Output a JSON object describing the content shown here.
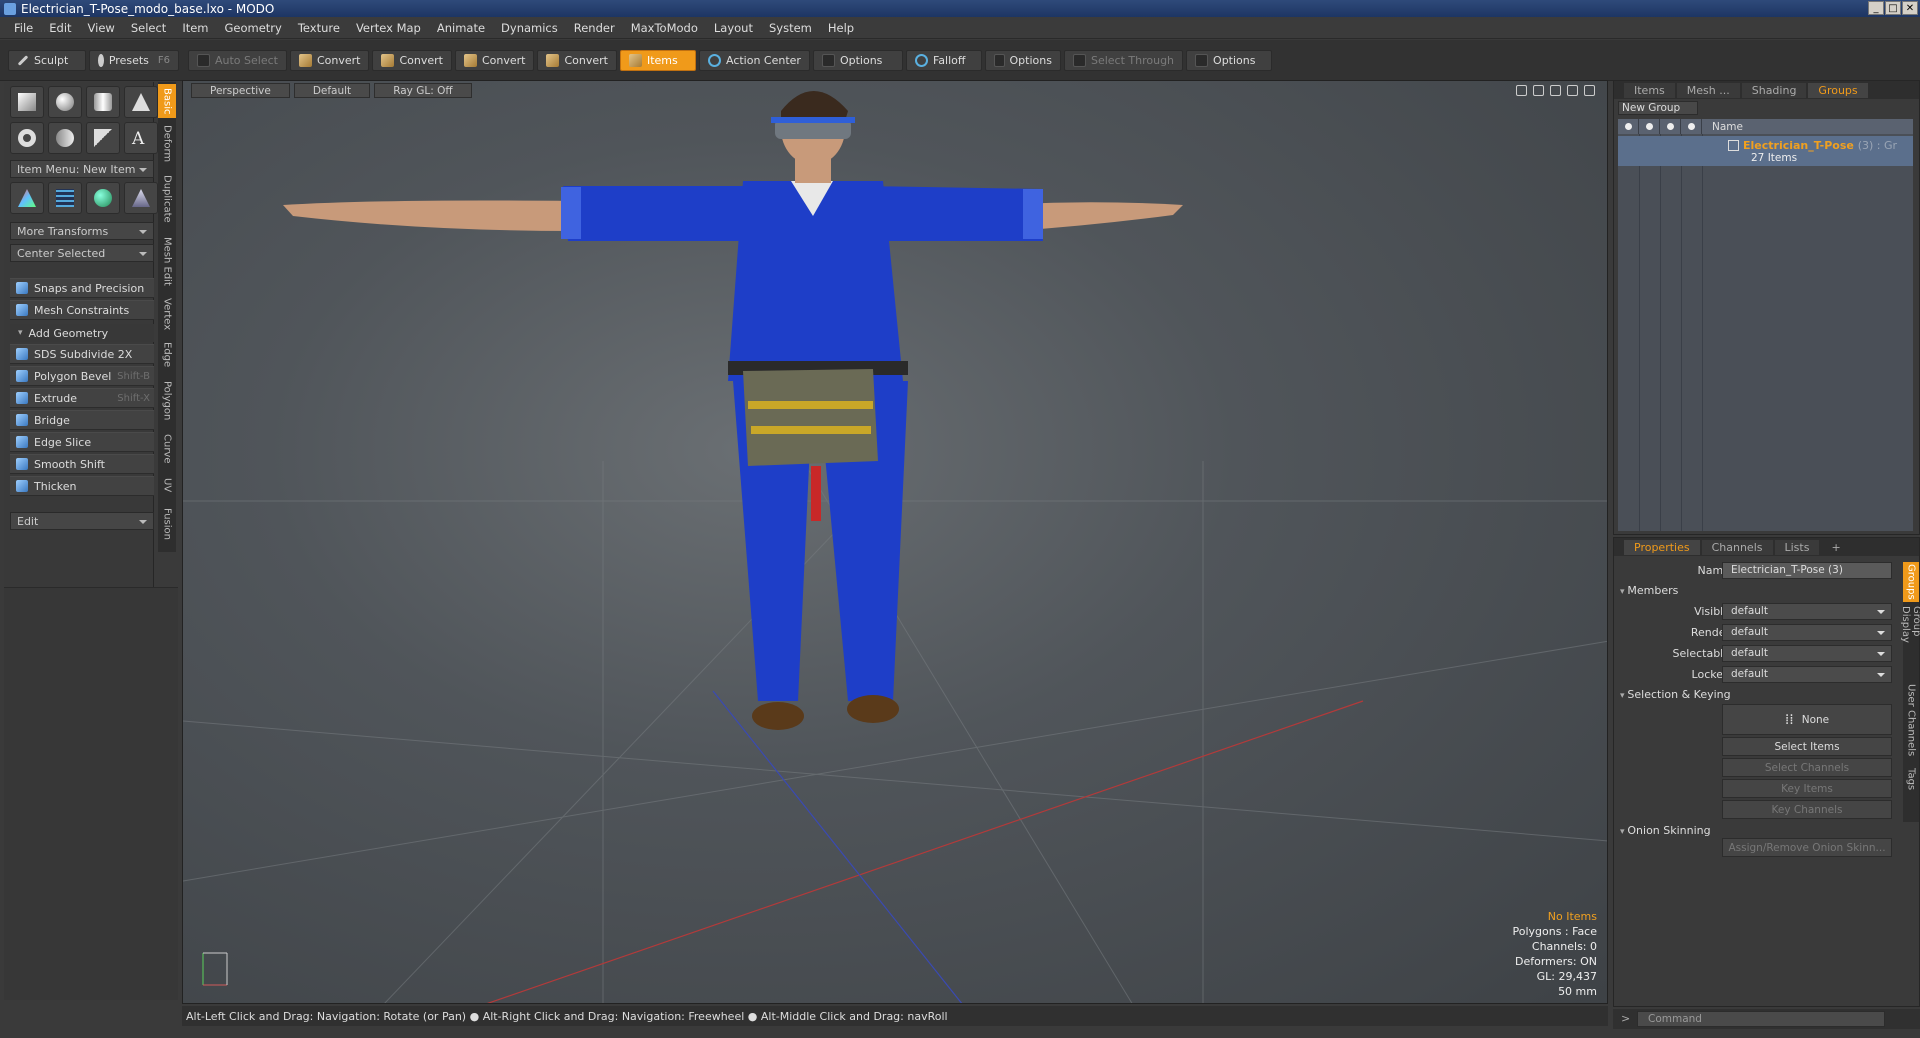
{
  "window": {
    "title": "Electrician_T-Pose_modo_base.lxo - MODO"
  },
  "menu": [
    "File",
    "Edit",
    "View",
    "Select",
    "Item",
    "Geometry",
    "Texture",
    "Vertex Map",
    "Animate",
    "Dynamics",
    "Render",
    "MaxToModo",
    "Layout",
    "System",
    "Help"
  ],
  "toolbar": {
    "sculpt": "Sculpt",
    "presets": "Presets",
    "presets_key": "F6",
    "auto_select": "Auto Select",
    "convert": "Convert",
    "items": "Items",
    "action_center": "Action Center",
    "options": "Options",
    "falloff": "Falloff",
    "select_through": "Select Through"
  },
  "left": {
    "item_menu": "Item Menu: New Item",
    "more_transforms": "More Transforms",
    "center_selected": "Center Selected",
    "snaps": "Snaps and Precision",
    "mesh_constraints": "Mesh Constraints",
    "add_geometry": "Add Geometry",
    "tools": [
      {
        "label": "SDS Subdivide 2X",
        "key": ""
      },
      {
        "label": "Polygon Bevel",
        "key": "Shift-B"
      },
      {
        "label": "Extrude",
        "key": "Shift-X"
      },
      {
        "label": "Bridge",
        "key": ""
      },
      {
        "label": "Edge Slice",
        "key": ""
      },
      {
        "label": "Smooth Shift",
        "key": ""
      },
      {
        "label": "Thicken",
        "key": ""
      }
    ],
    "edit": "Edit",
    "vtabs": [
      "Basic",
      "Deform",
      "Duplicate",
      "Mesh Edit",
      "Vertex",
      "Edge",
      "Polygon",
      "Curve",
      "UV",
      "Fusion"
    ]
  },
  "viewport": {
    "perspective": "Perspective",
    "default": "Default",
    "raygl": "Ray GL: Off",
    "info": {
      "items": "No Items",
      "polygons": "Polygons : Face",
      "channels": "Channels: 0",
      "deformers": "Deformers: ON",
      "gl": "GL: 29,437",
      "size": "50 mm"
    }
  },
  "status": "Alt-Left Click and Drag: Navigation: Rotate (or Pan) ● Alt-Right Click and Drag: Navigation: Freewheel ● Alt-Middle Click and Drag: navRoll",
  "right_top": {
    "tabs": [
      "Items",
      "Mesh ...",
      "Shading",
      "Groups"
    ],
    "new_group": "New Group",
    "col_name": "Name",
    "group_name": "Electrician_T-Pose",
    "group_suffix": "(3) : Gr",
    "group_count": "27 Items"
  },
  "properties": {
    "tabs": [
      "Properties",
      "Channels",
      "Lists",
      "+"
    ],
    "name_label": "Name",
    "name_value": "Electrician_T-Pose (3)",
    "members": "Members",
    "visible": "Visible",
    "render": "Render",
    "selectable": "Selectable",
    "locked": "Locked",
    "default": "default",
    "selection_keying": "Selection & Keying",
    "none": "None",
    "select_items": "Select Items",
    "select_channels": "Select Channels",
    "key_items": "Key Items",
    "key_channels": "Key Channels",
    "onion": "Onion Skinning",
    "assign": "Assign/Remove Onion Skinn...",
    "vtabs": [
      "Groups",
      "Group Display",
      "User Channels",
      "Tags"
    ]
  },
  "command": {
    "placeholder": "Command"
  }
}
